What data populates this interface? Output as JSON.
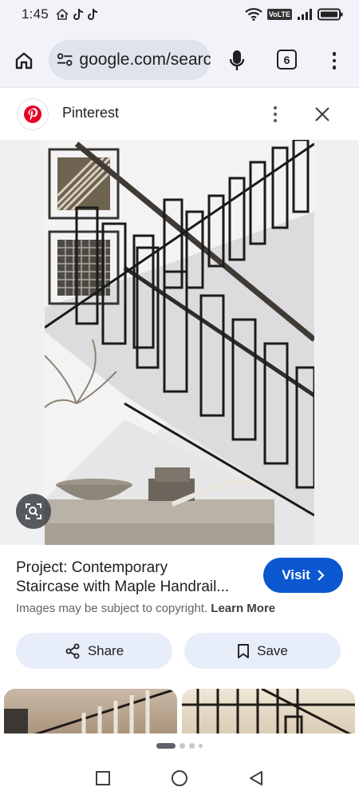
{
  "status_bar": {
    "time": "1:45",
    "network_label": "VoLTE"
  },
  "browser": {
    "url": "google.com/search",
    "tab_count": "6"
  },
  "source": {
    "name": "Pinterest",
    "brand_color": "#e60023"
  },
  "result": {
    "title_line1": "Project: Contemporary",
    "title_line2": "Staircase with Maple Handrail...",
    "visit_label": "Visit",
    "copyright_text": "Images may be subject to copyright.",
    "learn_more_label": "Learn More",
    "share_label": "Share",
    "save_label": "Save"
  },
  "colors": {
    "accent": "#0b57d0",
    "chip_bg": "#e8eef9",
    "toolbar_bg": "#f1f3f8"
  },
  "pager": {
    "active_index": 0,
    "total_visible": 4
  }
}
